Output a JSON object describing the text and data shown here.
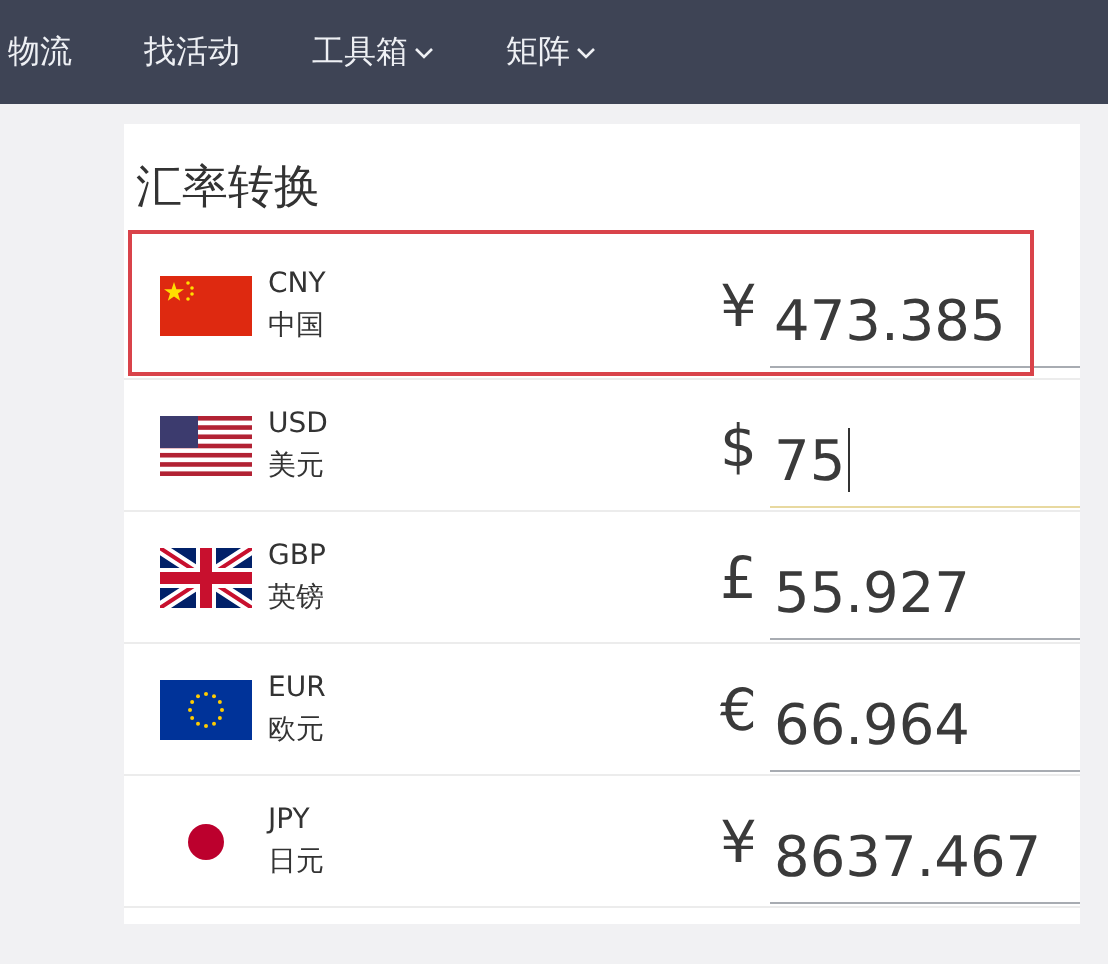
{
  "nav": [
    {
      "label": "物流",
      "has_menu": false
    },
    {
      "label": "找活动",
      "has_menu": false
    },
    {
      "label": "工具箱",
      "has_menu": true
    },
    {
      "label": "矩阵",
      "has_menu": true
    }
  ],
  "converter": {
    "title": "汇率转换",
    "rows": [
      {
        "kind": "cn",
        "code": "CNY",
        "name": "中国",
        "symbol": "¥",
        "value": "473.385",
        "highlighted": true,
        "focused": false
      },
      {
        "kind": "us",
        "code": "USD",
        "name": "美元",
        "symbol": "$",
        "value": "75",
        "highlighted": false,
        "focused": true
      },
      {
        "kind": "gb",
        "code": "GBP",
        "name": "英镑",
        "symbol": "£",
        "value": "55.927",
        "highlighted": false,
        "focused": false
      },
      {
        "kind": "eu",
        "code": "EUR",
        "name": "欧元",
        "symbol": "€",
        "value": "66.964",
        "highlighted": false,
        "focused": false
      },
      {
        "kind": "jp",
        "code": "JPY",
        "name": "日元",
        "symbol": "¥",
        "value": "8637.467",
        "highlighted": false,
        "focused": false
      }
    ]
  }
}
